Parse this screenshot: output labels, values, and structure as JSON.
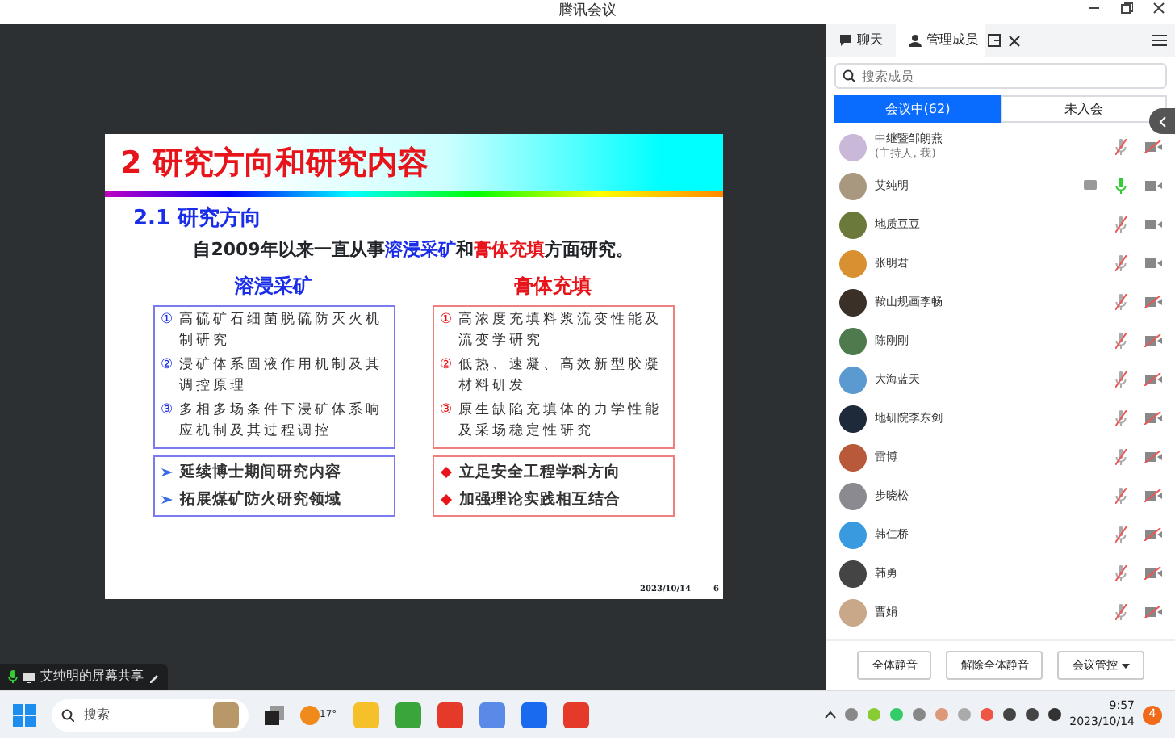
{
  "window": {
    "title": "腾讯会议"
  },
  "slide": {
    "title": "2 研究方向和研究内容",
    "subtitle": "2.1  研究方向",
    "intro": [
      {
        "kind": "plain",
        "text": "自2009年以来一直从事"
      },
      {
        "kind": "blue",
        "text": "溶浸采矿"
      },
      {
        "kind": "plain",
        "text": "和"
      },
      {
        "kind": "red",
        "text": "膏体充填"
      },
      {
        "kind": "plain",
        "text": "方面研究。"
      }
    ],
    "columns": [
      {
        "kind": "blue",
        "heading": "溶浸采矿",
        "items": [
          {
            "number": "①",
            "text": "高硫矿石细菌脱硫防灭火机制研究"
          },
          {
            "number": "②",
            "text": "浸矿体系固液作用机制及其调控原理"
          },
          {
            "number": "③",
            "text": "多相多场条件下浸矿体系响应机制及其过程调控"
          }
        ],
        "bullets": [
          "延续博士期间研究内容",
          "拓展煤矿防火研究领域"
        ]
      },
      {
        "kind": "red",
        "heading": "膏体充填",
        "items": [
          {
            "number": "①",
            "text": "高浓度充填料浆流变性能及流变学研究"
          },
          {
            "number": "②",
            "text": "低热、速凝、高效新型胶凝材料研发"
          },
          {
            "number": "③",
            "text": "原生缺陷充填体的力学性能及采场稳定性研究"
          }
        ],
        "bullets": [
          "立足安全工程学科方向",
          "加强理论实践相互结合"
        ]
      }
    ],
    "date": "2023/10/14",
    "page": "6"
  },
  "share_label": "艾纯明的屏幕共享",
  "panel": {
    "tabs": [
      {
        "label": "聊天",
        "selected": false
      },
      {
        "label": "管理成员",
        "selected": true
      }
    ],
    "search": {
      "placeholder": "搜索成员"
    },
    "segments": [
      {
        "label": "会议中(62)",
        "selected": true
      },
      {
        "label": "未入会",
        "selected": false
      }
    ],
    "members": [
      {
        "name": "中继暨邹朗燕",
        "role": "(主持人, 我)",
        "sharing": false,
        "mic_muted": true,
        "video_off": true
      },
      {
        "name": "艾纯明",
        "sharing": true,
        "mic_muted": false,
        "video_off": false
      },
      {
        "name": "地质豆豆",
        "sharing": false,
        "mic_muted": true,
        "video_off": false
      },
      {
        "name": "张明君",
        "sharing": false,
        "mic_muted": true,
        "video_off": false
      },
      {
        "name": "鞍山规画李畅",
        "sharing": false,
        "mic_muted": true,
        "video_off": true
      },
      {
        "name": "陈刚刚",
        "sharing": false,
        "mic_muted": true,
        "video_off": true
      },
      {
        "name": "大海蓝天",
        "sharing": false,
        "mic_muted": true,
        "video_off": true
      },
      {
        "name": "地研院李东剑",
        "sharing": false,
        "mic_muted": true,
        "video_off": true
      },
      {
        "name": "雷博",
        "sharing": false,
        "mic_muted": true,
        "video_off": true
      },
      {
        "name": "步晓松",
        "sharing": false,
        "mic_muted": true,
        "video_off": true
      },
      {
        "name": "韩仁桥",
        "sharing": false,
        "mic_muted": true,
        "video_off": true
      },
      {
        "name": "韩勇",
        "sharing": false,
        "mic_muted": true,
        "video_off": true
      },
      {
        "name": "曹娟",
        "sharing": false,
        "mic_muted": true,
        "video_off": true
      }
    ],
    "buttons": [
      {
        "label": "全体静音",
        "dropdown": false
      },
      {
        "label": "解除全体静音",
        "dropdown": false
      },
      {
        "label": "会议管控",
        "dropdown": true
      }
    ]
  },
  "taskbar": {
    "search_placeholder": "搜索",
    "weather": "17°",
    "time": "9:57",
    "date": "2023/10/14",
    "notifications": "4"
  }
}
